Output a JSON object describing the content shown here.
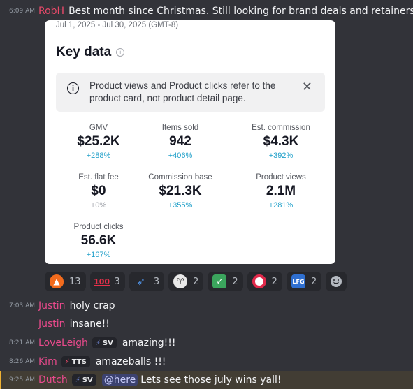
{
  "messages": {
    "m0": {
      "time": "6:09 AM",
      "author": "RobH",
      "author_color": "#e94a6a",
      "text": "Best month since Christmas. Still looking for brand deals and retainers."
    },
    "m1": {
      "time": "7:03 AM",
      "author": "Justin",
      "author_color": "#e94a8c",
      "text": "holy crap"
    },
    "m2": {
      "author": "Justin",
      "author_color": "#e94a8c",
      "text": "insane!!"
    },
    "m3": {
      "time": "8:21 AM",
      "author": "LoveLeigh",
      "author_color": "#e94a8c",
      "badge": "SV",
      "text": "amazing!!!"
    },
    "m4": {
      "time": "8:26 AM",
      "author": "Kim",
      "author_color": "#e94a8c",
      "badge": "TTS",
      "text": "amazeballs !!!"
    },
    "m5": {
      "time": "9:25 AM",
      "author": "Dutch",
      "author_color": "#e94a8c",
      "badge": "SV",
      "mention": "@here",
      "text": "Lets see those july wins yall!"
    }
  },
  "card": {
    "date_range": "Jul 1, 2025 - Jul 30, 2025 (GMT-8)",
    "title": "Key data",
    "notice": "Product views and Product clicks refer to the product card, not product detail page.",
    "metrics": [
      {
        "label": "GMV",
        "value": "$25.2K",
        "change": "+288%"
      },
      {
        "label": "Items sold",
        "value": "942",
        "change": "+406%"
      },
      {
        "label": "Est. commission",
        "value": "$4.3K",
        "change": "+392%"
      },
      {
        "label": "Est. flat fee",
        "value": "$0",
        "change": "+0%"
      },
      {
        "label": "Commission base",
        "value": "$21.3K",
        "change": "+355%"
      },
      {
        "label": "Product views",
        "value": "2.1M",
        "change": "+281%"
      },
      {
        "label": "Product clicks",
        "value": "56.6K",
        "change": "+167%"
      }
    ]
  },
  "reactions": [
    {
      "icon": "fire-emoji-icon",
      "count": "13"
    },
    {
      "icon": "hundred-emoji-icon",
      "count": "3"
    },
    {
      "icon": "rocket-emoji-icon",
      "count": "3"
    },
    {
      "icon": "goat-emoji-icon",
      "count": "2"
    },
    {
      "icon": "check-mark-emoji-icon",
      "count": "2"
    },
    {
      "icon": "target-emoji-icon",
      "count": "2"
    },
    {
      "icon": "lfg-emoji-icon",
      "count": "2"
    }
  ],
  "colors": {
    "background": "#323339",
    "link_accent": "#1e9fc9",
    "highlight_bar": "#f0b232"
  }
}
